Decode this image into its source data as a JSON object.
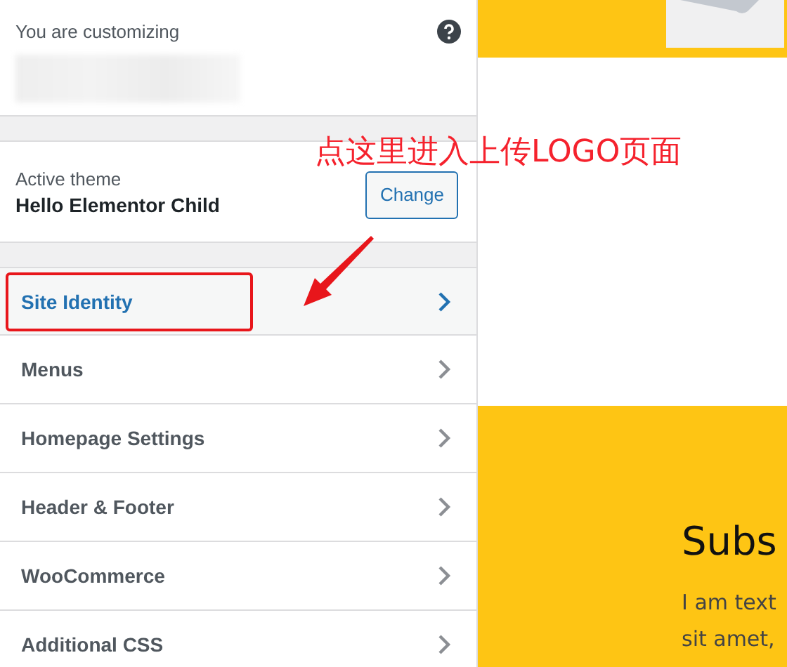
{
  "header": {
    "label": "You are customizing"
  },
  "active_theme": {
    "label": "Active theme",
    "name": "Hello Elementor Child",
    "button": "Change"
  },
  "sections": [
    {
      "label": "Site Identity",
      "selected": true
    },
    {
      "label": "Menus",
      "selected": false
    },
    {
      "label": "Homepage Settings",
      "selected": false
    },
    {
      "label": "Header & Footer",
      "selected": false
    },
    {
      "label": "WooCommerce",
      "selected": false
    },
    {
      "label": "Additional CSS",
      "selected": false
    }
  ],
  "annotation": {
    "text": "点这里进入上传LOGO页面"
  },
  "preview": {
    "heading": "Subs",
    "text_lines": [
      "I am text",
      "sit amet,"
    ]
  }
}
